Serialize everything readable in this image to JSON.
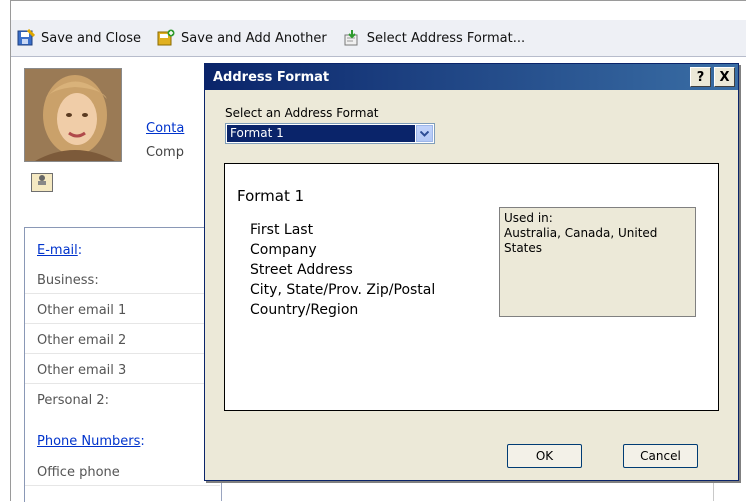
{
  "toolbar": {
    "save_close": "Save and Close",
    "save_add": "Save and Add Another",
    "select_format": "Select Address Format..."
  },
  "contact": {
    "link": "Conta",
    "company": "Comp"
  },
  "left_panel": {
    "email_link": "E-mail",
    "email_colon": ":",
    "rows": [
      "Business:",
      "Other email 1",
      "Other email 2",
      "Other email 3",
      "Personal 2:"
    ],
    "phone_link": "Phone Numbers",
    "phone_colon": ":",
    "office_phone": "Office phone"
  },
  "dialog": {
    "title": "Address Format",
    "help_glyph": "?",
    "close_glyph": "X",
    "select_label": "Select an Address Format",
    "selected_format": "Format 1",
    "preview_title": "Format 1",
    "preview_lines": [
      "First Last",
      "Company",
      "Street Address",
      "City, State/Prov. Zip/Postal",
      "Country/Region"
    ],
    "used_in_label": "Used in:",
    "used_in_value": "Australia, Canada, United States",
    "ok": "OK",
    "cancel": "Cancel"
  },
  "colors": {
    "titlebar": "#0a246a",
    "link": "#0033cc",
    "dialog_bg": "#ece9d8"
  }
}
